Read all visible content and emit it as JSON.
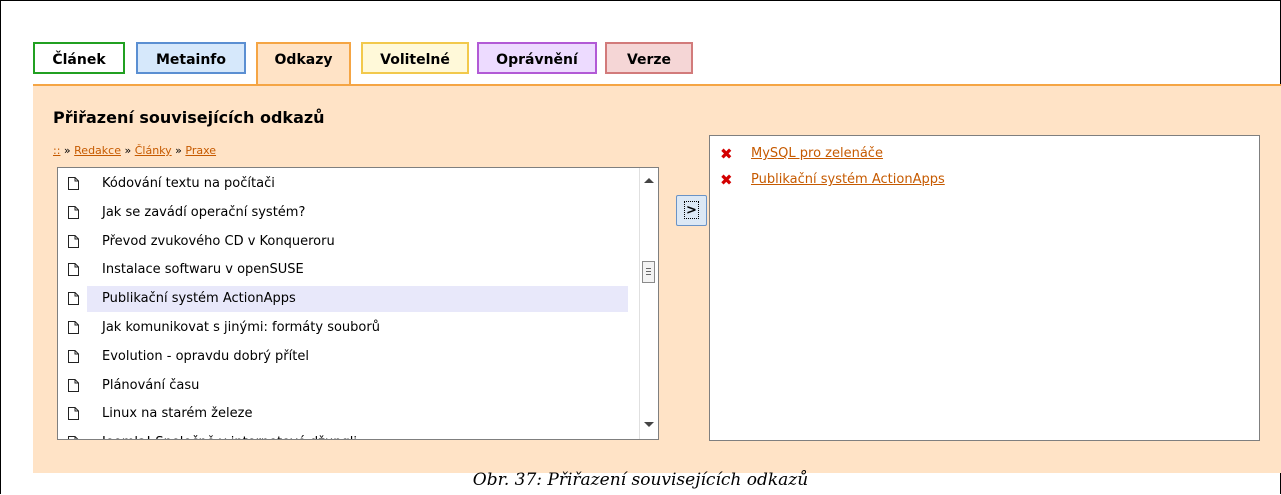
{
  "tabs": [
    {
      "label": "Článek",
      "border": "#21a021",
      "bg": "#ffffff"
    },
    {
      "label": "Metainfo",
      "border": "#5b8fd2",
      "bg": "#d6e8fb"
    },
    {
      "label": "Odkazy",
      "border": "#f5a544",
      "bg": "#ffe3c6"
    },
    {
      "label": "Volitelné",
      "border": "#f2c94c",
      "bg": "#fff9d9"
    },
    {
      "label": "Oprávnění",
      "border": "#b25ad6",
      "bg": "#eddbff"
    },
    {
      "label": "Verze",
      "border": "#d27b7b",
      "bg": "#f5d6d6"
    }
  ],
  "panel": {
    "heading": "Přiřazení souvisejících odkazů"
  },
  "breadcrumb": {
    "root": "::",
    "sep": "»",
    "items": [
      "Redakce",
      "Články",
      "Praxe"
    ]
  },
  "articles": [
    "Kódování textu na počítači",
    "Jak se zavádí operační systém?",
    "Převod zvukového CD v Konqueroru",
    "Instalace softwaru v openSUSE",
    "Publikační systém ActionApps",
    "Jak komunikovat s jinými: formáty souborů",
    "Evolution - opravdu dobrý přítel",
    "Plánování času",
    "Linux na starém železe",
    "Joomla! Společně v internetové džungli"
  ],
  "selected_article": "Publikační systém ActionApps",
  "move_button": {
    "label": ">"
  },
  "linked": [
    {
      "label": "MySQL pro zelenáče"
    },
    {
      "label": "Publikační systém ActionApps"
    }
  ],
  "caption": "Obr. 37: Přiřazení souvisejících odkazů",
  "icons": {
    "document": "document-icon",
    "remove": "remove-icon"
  }
}
